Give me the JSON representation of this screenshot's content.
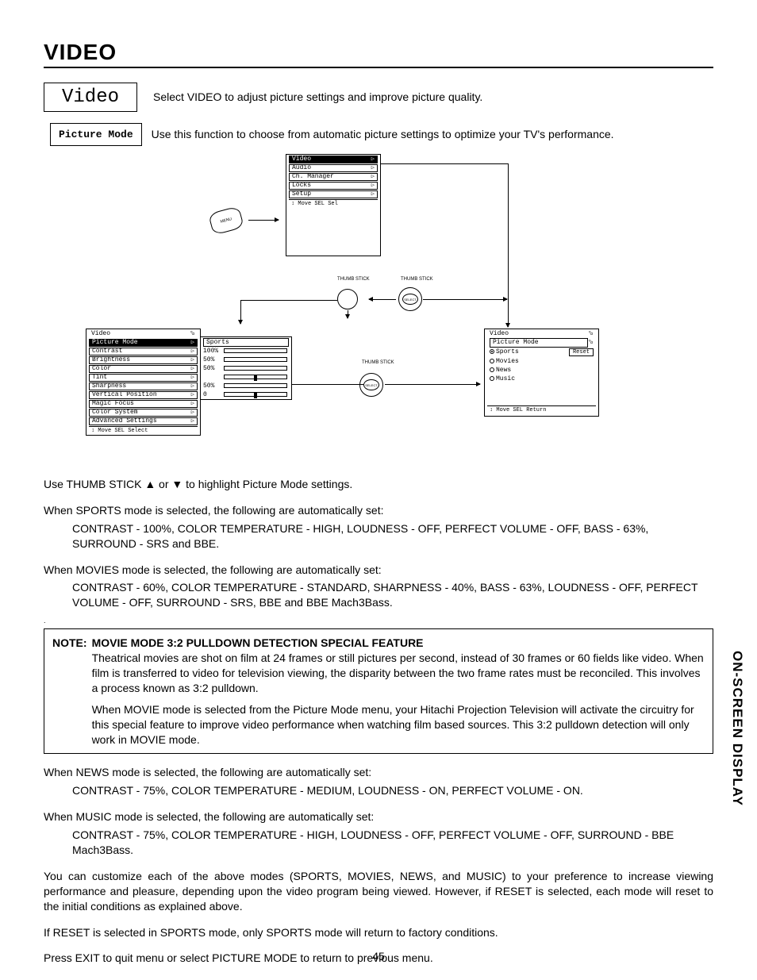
{
  "title": "VIDEO",
  "video_box": "Video",
  "video_desc": "Select VIDEO to adjust picture settings and improve picture quality.",
  "picture_mode_box": "Picture Mode",
  "picture_mode_desc": "Use this function to choose from automatic picture settings to optimize your TV's performance.",
  "remote_label": "MENU",
  "thumb_label": "THUMB\nSTICK",
  "select_label": "SELECT",
  "main_menu": {
    "items": [
      "Video",
      "Audio",
      "Ch. Manager",
      "Locks",
      "Setup"
    ],
    "footer": "↕ Move  SEL  Sel"
  },
  "video_menu": {
    "title": "Video",
    "items": [
      "Picture Mode",
      "Contrast",
      "Brightness",
      "Color",
      "Tint",
      "Sharpness",
      "Vertical Position",
      "Magic Focus",
      "Color System",
      "Advanced Settings"
    ],
    "footer": "↕ Move  SEL  Select"
  },
  "values_panel": {
    "rows": [
      {
        "label": "Sports",
        "val": ""
      },
      {
        "label": "100%",
        "fill": 100
      },
      {
        "label": "50%",
        "fill": 50
      },
      {
        "label": "50%",
        "fill": 50
      },
      {
        "label": "",
        "marker": 50
      },
      {
        "label": "50%",
        "fill": 50
      },
      {
        "label": "0",
        "marker": 50
      }
    ]
  },
  "picture_mode_submenu": {
    "title": "Video",
    "subtitle": "Picture Mode",
    "reset": "Reset",
    "options": [
      "Sports",
      "Movies",
      "News",
      "Music"
    ],
    "footer": "↕ Move  SEL  Return"
  },
  "body": {
    "thumbstick_instr": "Use THUMB STICK ▲ or ▼ to highlight Picture Mode settings.",
    "sports_head": "When SPORTS mode is selected, the following are automatically set:",
    "sports_body": "CONTRAST - 100%, COLOR TEMPERATURE - HIGH, LOUDNESS - OFF, PERFECT VOLUME - OFF,  BASS - 63%, SURROUND - SRS and BBE.",
    "movies_head": "When MOVIES mode is selected, the following are automatically set:",
    "movies_body": "CONTRAST - 60%, COLOR TEMPERATURE - STANDARD, SHARPNESS - 40%, BASS - 63%, LOUDNESS - OFF, PERFECT VOLUME - OFF, SURROUND - SRS, BBE and BBE Mach3Bass.",
    "note_label": "NOTE:",
    "note_title": "MOVIE MODE 3:2 PULLDOWN DETECTION SPECIAL FEATURE",
    "note_p1": "Theatrical movies are shot on film at 24 frames or still pictures per second, instead of 30 frames or 60 fields like video.  When film is transferred to video for television viewing, the disparity between the two frame rates must be reconciled.  This involves a process known as 3:2 pulldown.",
    "note_p2": "When MOVIE mode is selected from the Picture Mode menu, your Hitachi Projection Television will activate the circuitry for this special feature to improve video performance when watching film based sources.  This 3:2 pulldown detection will only work in MOVIE mode.",
    "news_head": "When NEWS mode is selected, the following are automatically set:",
    "news_body": "CONTRAST - 75%, COLOR TEMPERATURE - MEDIUM, LOUDNESS - ON, PERFECT VOLUME - ON.",
    "music_head": "When MUSIC mode is selected, the following are automatically set:",
    "music_body": "CONTRAST - 75%, COLOR TEMPERATURE - HIGH, LOUDNESS - OFF, PERFECT VOLUME - OFF, SURROUND - BBE Mach3Bass.",
    "customize": "You can customize each of the above modes (SPORTS, MOVIES, NEWS, and MUSIC) to your preference to increase viewing performance and pleasure, depending upon the video program being viewed. However, if RESET is selected, each mode will reset to the initial conditions as explained above.",
    "reset_note": "If RESET is selected in SPORTS mode, only SPORTS mode will return to factory conditions.",
    "exit_note": "Press EXIT to quit menu or select PICTURE MODE to return to previous menu."
  },
  "side_label": "ON-SCREEN DISPLAY",
  "page_number": "45"
}
